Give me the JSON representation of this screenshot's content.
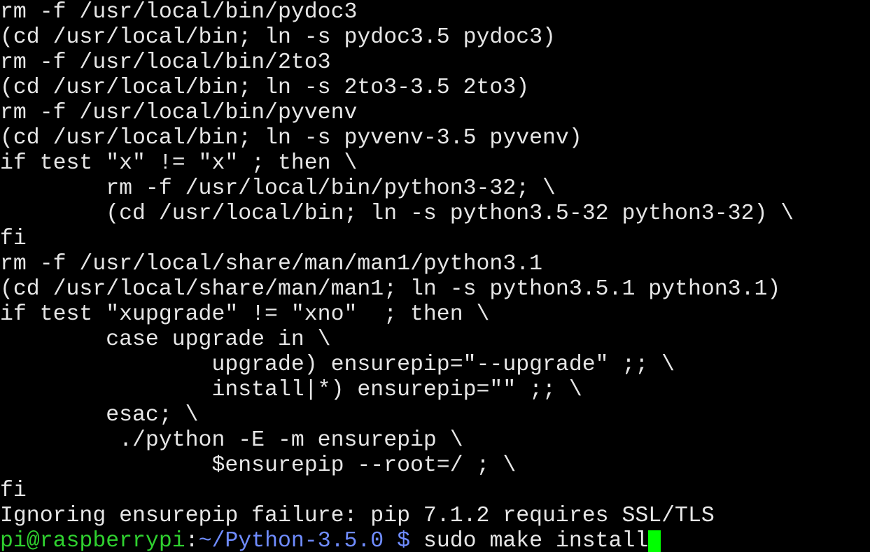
{
  "terminal": {
    "colors": {
      "background": "#000000",
      "foreground": "#e6e6e6",
      "user": "#2fd12f",
      "path": "#6f8cff",
      "cursor": "#00ff00"
    },
    "lines": [
      "rm -f /usr/local/bin/pydoc3",
      "(cd /usr/local/bin; ln -s pydoc3.5 pydoc3)",
      "rm -f /usr/local/bin/2to3",
      "(cd /usr/local/bin; ln -s 2to3-3.5 2to3)",
      "rm -f /usr/local/bin/pyvenv",
      "(cd /usr/local/bin; ln -s pyvenv-3.5 pyvenv)",
      "if test \"x\" != \"x\" ; then \\",
      "        rm -f /usr/local/bin/python3-32; \\",
      "        (cd /usr/local/bin; ln -s python3.5-32 python3-32) \\",
      "fi",
      "rm -f /usr/local/share/man/man1/python3.1",
      "(cd /usr/local/share/man/man1; ln -s python3.5.1 python3.1)",
      "if test \"xupgrade\" != \"xno\"  ; then \\",
      "        case upgrade in \\",
      "                upgrade) ensurepip=\"--upgrade\" ;; \\",
      "                install|*) ensurepip=\"\" ;; \\",
      "        esac; \\",
      "         ./python -E -m ensurepip \\",
      "                $ensurepip --root=/ ; \\",
      "fi",
      "Ignoring ensurepip failure: pip 7.1.2 requires SSL/TLS"
    ],
    "prompt": {
      "user_host": "pi@raspberrypi",
      "separator": ":",
      "path": "~/Python-3.5.0",
      "symbol": " $",
      "command": " sudo make install"
    }
  }
}
